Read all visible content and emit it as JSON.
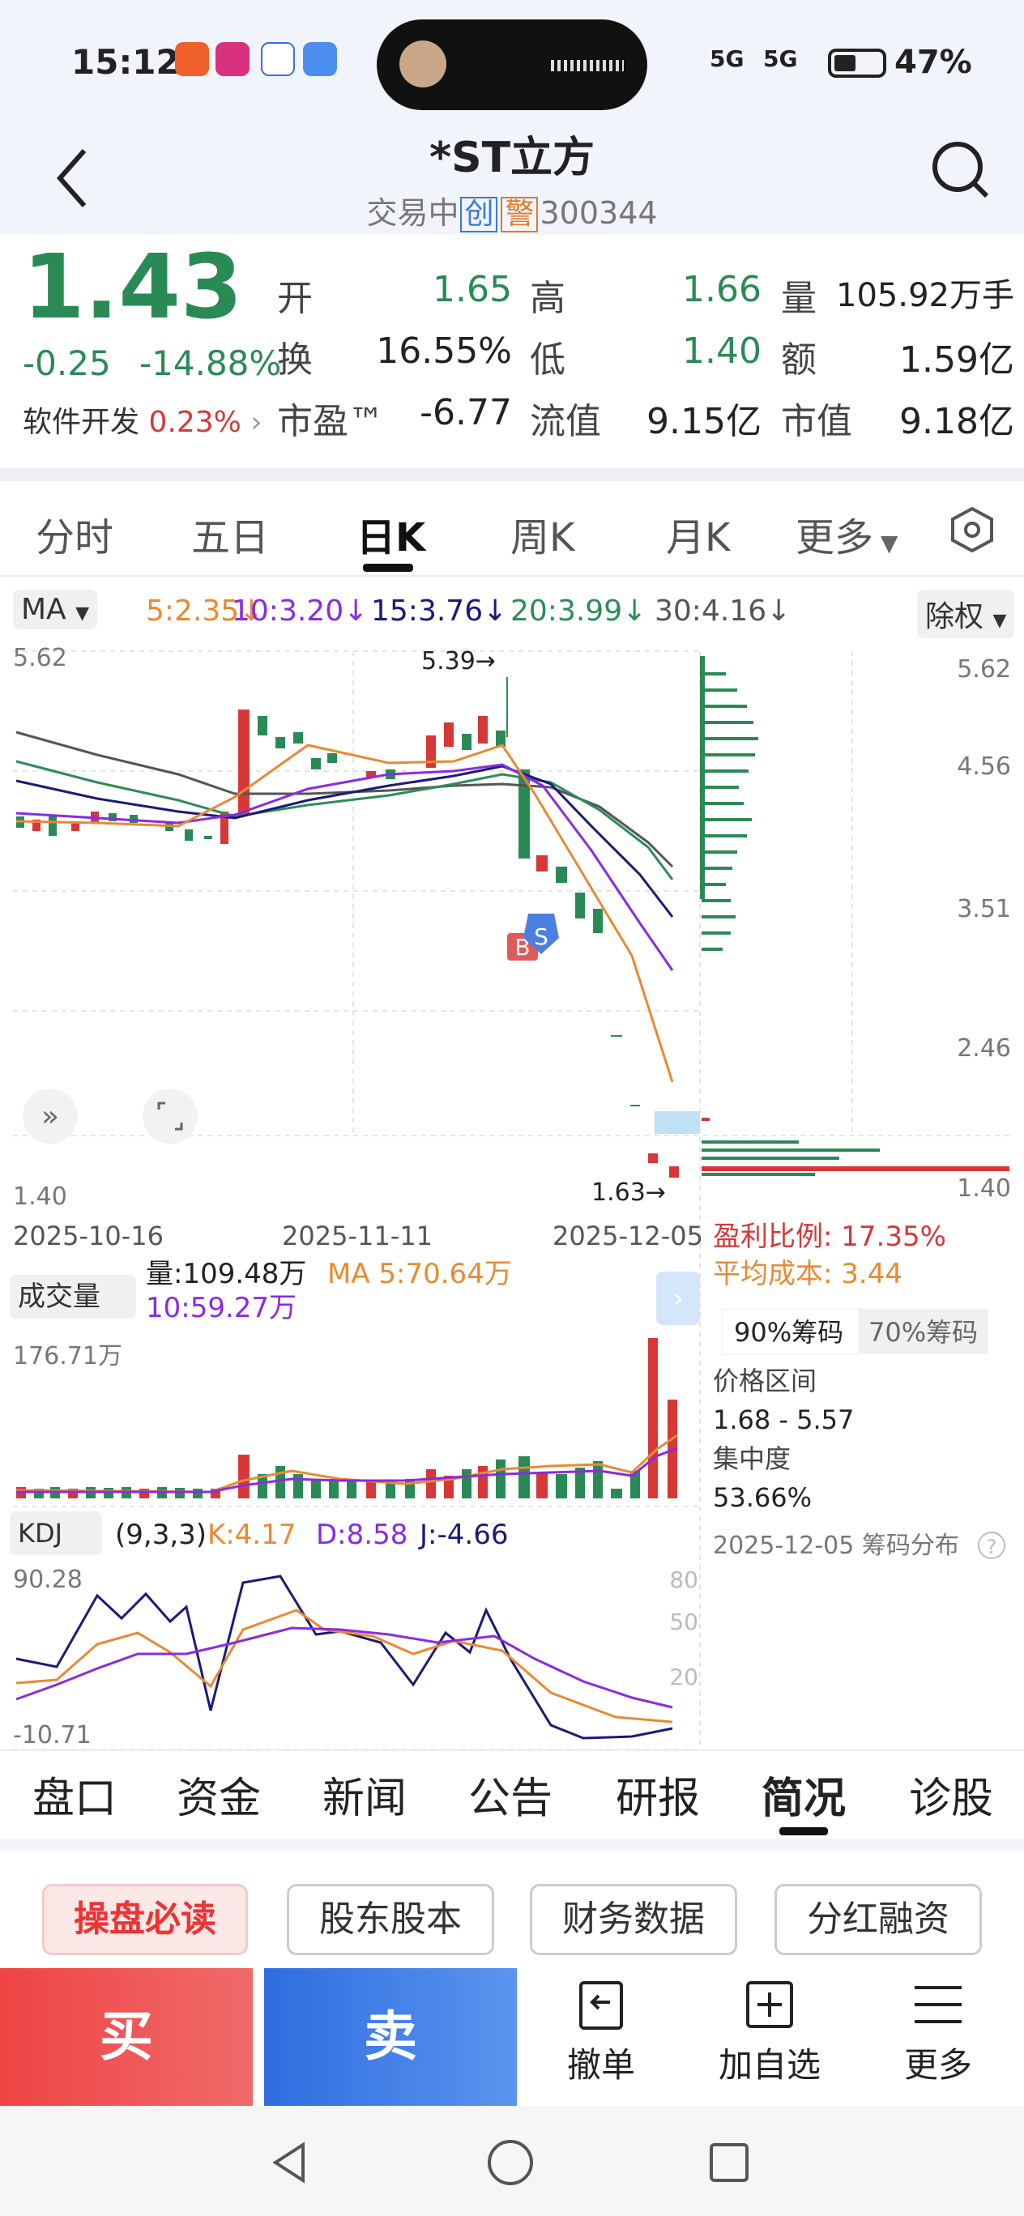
{
  "status_bar": {
    "time": "15:12",
    "signal_1": "5G",
    "signal_2": "5G",
    "battery": "47%"
  },
  "header": {
    "title": "*ST立方",
    "status": "交易中",
    "tag_1": "创",
    "tag_2": "警",
    "code": "300344"
  },
  "quote": {
    "price": "1.43",
    "change": "-0.25",
    "change_pct": "-14.88%",
    "sector_name": "软件开发",
    "sector_pct": "0.23%",
    "open_label": "开",
    "open": "1.65",
    "high_label": "高",
    "high": "1.66",
    "volume_label": "量",
    "volume": "105.92万手",
    "turnover_label": "换",
    "turnover": "16.55%",
    "low_label": "低",
    "low": "1.40",
    "amount_label": "额",
    "amount": "1.59亿",
    "pe_label": "市盈™",
    "pe": "-6.77",
    "float_label": "流值",
    "float_value": "9.15亿",
    "mktcap_label": "市值",
    "mktcap": "9.18亿"
  },
  "kline_tabs": [
    "分时",
    "五日",
    "日K",
    "周K",
    "月K",
    "更多"
  ],
  "ma_row": {
    "selector": "MA",
    "ma5": "5:2.35",
    "ma10": "10:3.20",
    "ma15": "15:3.76",
    "ma20": "20:3.99",
    "ma30": "30:4.16",
    "adjust": "除权"
  },
  "price_axis": [
    "5.62",
    "4.56",
    "3.51",
    "2.46",
    "1.40"
  ],
  "price_left": {
    "top": "5.62",
    "bottom": "1.40"
  },
  "annotations": {
    "high": "5.39",
    "low": "1.63",
    "buy_marker": "B",
    "sell_marker": "S"
  },
  "dates": [
    "2025-10-16",
    "2025-11-11",
    "2025-12-05"
  ],
  "chip_info": {
    "profit_label": "盈利比例:",
    "profit": "17.35%",
    "avg_label": "平均成本:",
    "avg": "3.44",
    "tab_90": "90%筹码",
    "tab_70": "70%筹码",
    "range_label": "价格区间",
    "range": "1.68 - 5.57",
    "conc_label": "集中度",
    "conc": "53.66%",
    "footer": "2025-12-05 筹码分布"
  },
  "volume_panel": {
    "selector": "成交量",
    "vol": "量:109.48万",
    "ma5": "MA 5:70.64万",
    "ma10": "10:59.27万",
    "max": "176.71万"
  },
  "kdj_panel": {
    "selector": "KDJ",
    "params": "(9,3,3)",
    "k": "K:4.17",
    "d": "D:8.58",
    "j": "J:-4.66",
    "max": "90.28",
    "min": "-10.71",
    "levels": [
      "80",
      "50",
      "20"
    ]
  },
  "bottom_tabs": [
    "盘口",
    "资金",
    "新闻",
    "公告",
    "研报",
    "简况",
    "诊股"
  ],
  "chips": [
    "操盘必读",
    "股东股本",
    "财务数据",
    "分红融资"
  ],
  "actions": {
    "buy": "买",
    "sell": "卖",
    "cancel": "撤单",
    "add": "加自选",
    "more": "更多"
  },
  "colors": {
    "up": "#d63838",
    "down": "#2a8a55",
    "ma5": "#e88a33",
    "ma10": "#8a2be2",
    "ma15": "#1a1a7a",
    "ma20": "#2e8b57",
    "ma30": "#555555"
  }
}
